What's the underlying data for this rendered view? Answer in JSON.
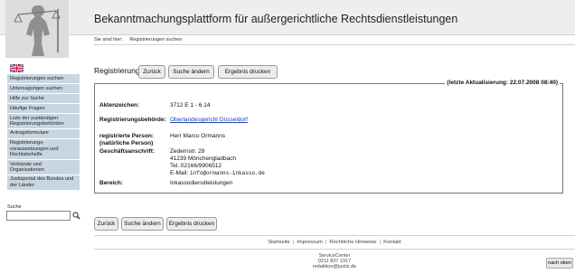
{
  "header": {
    "title": "Bekanntmachungsplattform für außergerichtliche Rechtsdienstleistungen"
  },
  "breadcrumb": {
    "prefix": "Sie sind hier:",
    "current": "Registrierungen suchen"
  },
  "sidebar": {
    "language_icon": "uk-flag-icon",
    "items": [
      {
        "label": "Registrierungen suchen"
      },
      {
        "label": "Untersagungen suchen"
      },
      {
        "label": "Hilfe zur Suche"
      },
      {
        "label": "Häufige Fragen"
      },
      {
        "label": "Liste der zuständigen Registrierungsbehörden"
      },
      {
        "label": "Antragsformulare"
      },
      {
        "label": "Registrierungs-voraussetzungen und Rechtsbehelfe"
      },
      {
        "label": "Verbände und Organisationen"
      },
      {
        "label": "Justizportal des Bundes und der Länder"
      }
    ],
    "search_label": "Suche",
    "search_value": ""
  },
  "toolbar": {
    "title": "Registrierung",
    "back": "Zurück",
    "change_search": "Suche ändern",
    "print": "Ergebnis drucken"
  },
  "details": {
    "last_update": "(letzte Aktualisierung: 22.07.2008 08:40)",
    "file_label": "Aktenzeichen:",
    "file_value": "3712 E 1 - 6.14",
    "authority_label": "Registrierungsbehörde:",
    "authority_value": "Oberlandesgericht Düsseldorf",
    "person_label_1": "registrierte Person:",
    "person_label_2": "(natürliche Person)",
    "person_value": "Herr Marco Ormanns",
    "address_label": "Geschäftsanschrift:",
    "address_lines": [
      "Zedernstr. 29",
      "41239 Mönchengladbach",
      "Tel.:02166/9906512"
    ],
    "email_prefix": "E-Mail:",
    "email_value": "info@ormanns-inkasso.de",
    "area_label": "Bereich:",
    "area_value": "Inkassodienstleistungen"
  },
  "footer": {
    "links": [
      "Startseite",
      "Impressum",
      "Rechtliche Hinweise",
      "Kontakt"
    ],
    "service_title": "ServiceCenter",
    "service_phone": "0211 837 1917",
    "service_email": "redaktion@justiz.de",
    "to_top": "nach oben"
  }
}
